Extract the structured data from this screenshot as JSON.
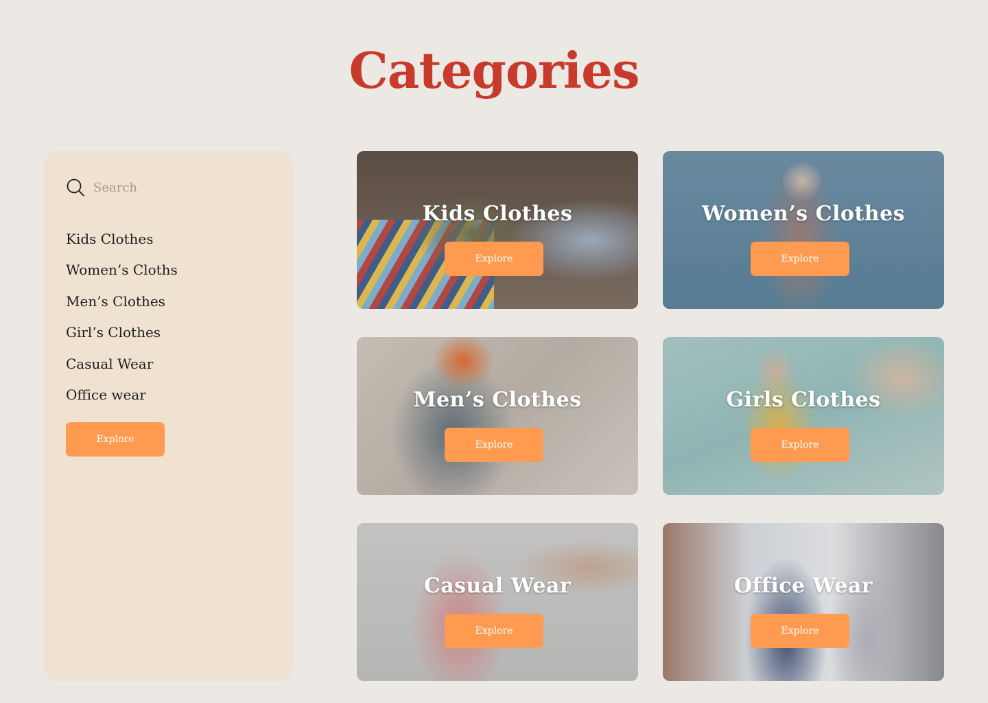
{
  "page": {
    "title": "Categories"
  },
  "colors": {
    "background": "#ECE8E3",
    "title": "#C73A2C",
    "sidebar_bg": "#EFE2D0",
    "button_bg": "#FE9B51",
    "button_text": "#FFFFFF"
  },
  "sidebar": {
    "search": {
      "placeholder": "Search",
      "value": "",
      "icon": "search-icon"
    },
    "items": [
      {
        "label": "Kids Clothes"
      },
      {
        "label": "Women’s Cloths"
      },
      {
        "label": "Men’s Clothes"
      },
      {
        "label": "Girl’s Clothes"
      },
      {
        "label": "Casual Wear"
      },
      {
        "label": "Office wear"
      }
    ],
    "explore_label": "Explore"
  },
  "cards": [
    {
      "title": "Kids Clothes",
      "button": "Explore"
    },
    {
      "title": "Women’s Clothes",
      "button": "Explore"
    },
    {
      "title": "Men’s Clothes",
      "button": "Explore"
    },
    {
      "title": "Girls Clothes",
      "button": "Explore"
    },
    {
      "title": "Casual Wear",
      "button": "Explore"
    },
    {
      "title": "Office Wear",
      "button": "Explore"
    }
  ]
}
